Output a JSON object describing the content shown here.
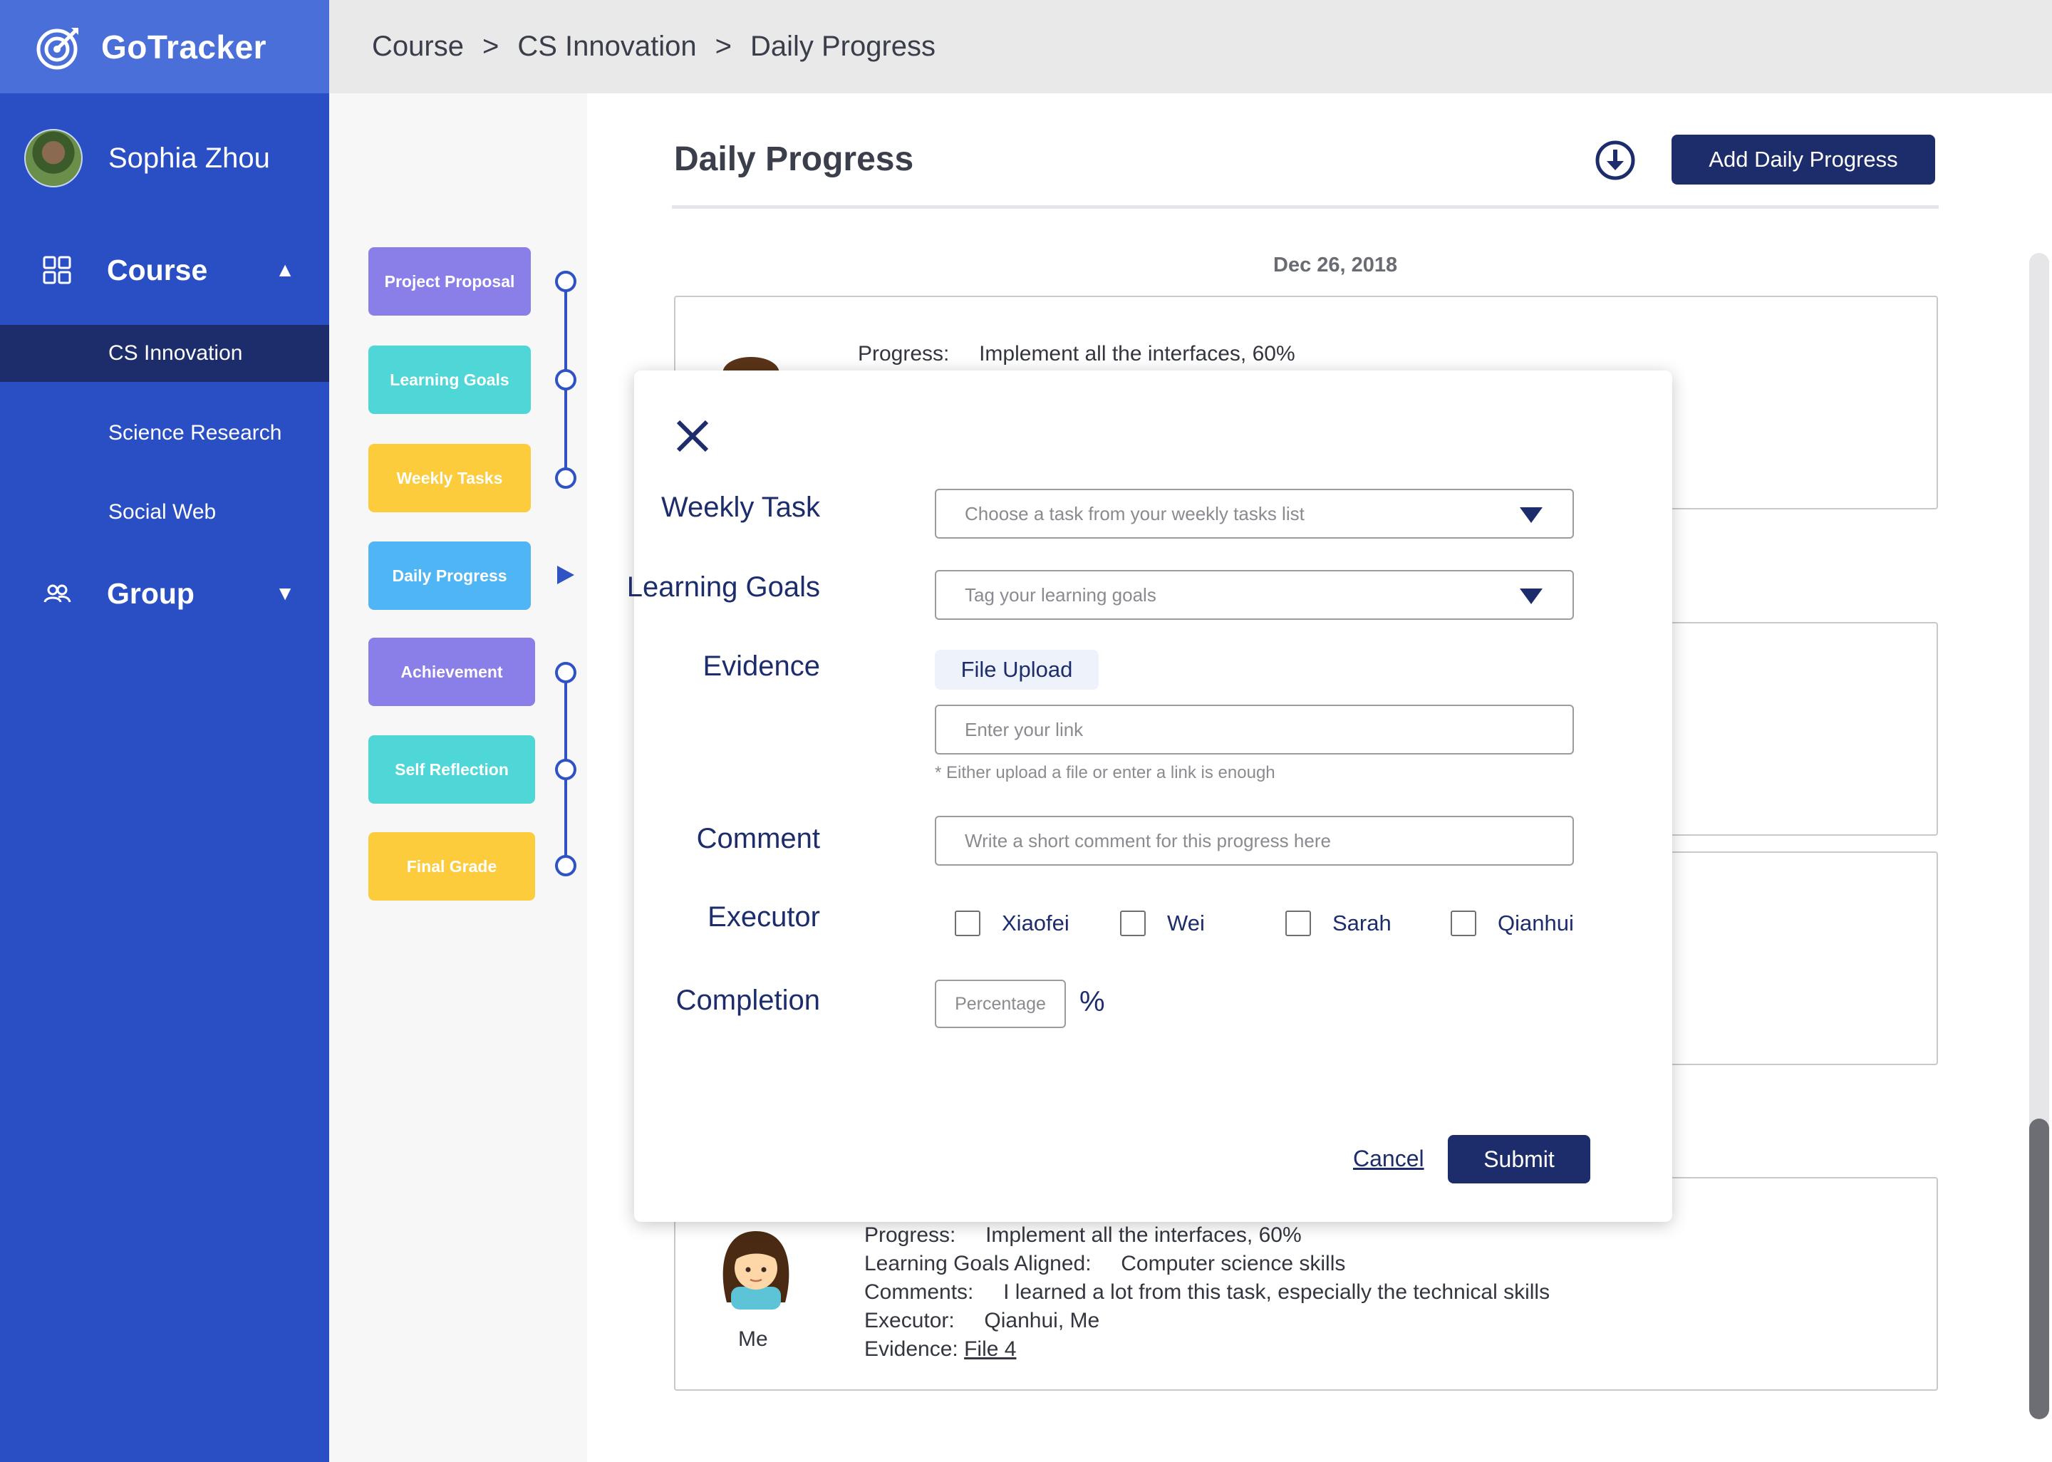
{
  "brand": {
    "name": "GoTracker"
  },
  "user": {
    "name": "Sophia Zhou"
  },
  "sidebar": {
    "course_label": "Course",
    "courses": [
      "CS Innovation",
      "Science Research",
      "Social Web"
    ],
    "group_label": "Group"
  },
  "breadcrumb": [
    "Course",
    "CS Innovation",
    "Daily Progress"
  ],
  "breadcrumb_sep": ">",
  "stages": [
    "Project Proposal",
    "Learning Goals",
    "Weekly Tasks",
    "Daily Progress",
    "Achievement",
    "Self Reflection",
    "Final Grade"
  ],
  "page": {
    "title": "Daily Progress",
    "add_button": "Add Daily Progress",
    "date": "Dec 26, 2018"
  },
  "entry_top": {
    "progress_label": "Progress:",
    "progress_value": "Implement all the interfaces, 60%"
  },
  "entry_bottom": {
    "progress_label": "Progress:",
    "progress_value": "Implement all the interfaces, 60%",
    "goals_label": "Learning Goals Aligned:",
    "goals_value": "Computer science skills",
    "comments_label": "Comments:",
    "comments_value": "I learned a lot from this task, especially the technical skills",
    "executor_label": "Executor:",
    "executor_value": "Qianhui, Me",
    "evidence_label": "Evidence:",
    "evidence_link": "File 4",
    "person": "Me"
  },
  "modal": {
    "weekly_task_label": "Weekly Task",
    "weekly_task_placeholder": "Choose a task from your weekly tasks list",
    "learning_goals_label": "Learning Goals",
    "learning_goals_placeholder": "Tag your learning goals",
    "evidence_label": "Evidence",
    "file_upload": "File Upload",
    "link_placeholder": "Enter your link",
    "hint": "* Either upload a file or enter a link is enough",
    "comment_label": "Comment",
    "comment_placeholder": "Write a short comment for this progress here",
    "executor_label": "Executor",
    "executors": [
      "Xiaofei",
      "Wei",
      "Sarah",
      "Qianhui"
    ],
    "completion_label": "Completion",
    "completion_placeholder": "Percentage",
    "completion_unit": "%",
    "cancel": "Cancel",
    "submit": "Submit"
  },
  "colors": {
    "sidebar": "#2a4fc4",
    "sidebar_active": "#1d2d6b",
    "brand_bar": "#4a6fd9",
    "primary_button": "#1d2d6b",
    "stage_purple": "#8a7ee8",
    "stage_teal": "#4fd6d6",
    "stage_yellow": "#fccc3c",
    "stage_blue": "#50b5f5"
  },
  "icons": [
    "target-icon",
    "grid-icon",
    "group-icon",
    "download-icon",
    "close-icon",
    "chevron-down-icon"
  ]
}
